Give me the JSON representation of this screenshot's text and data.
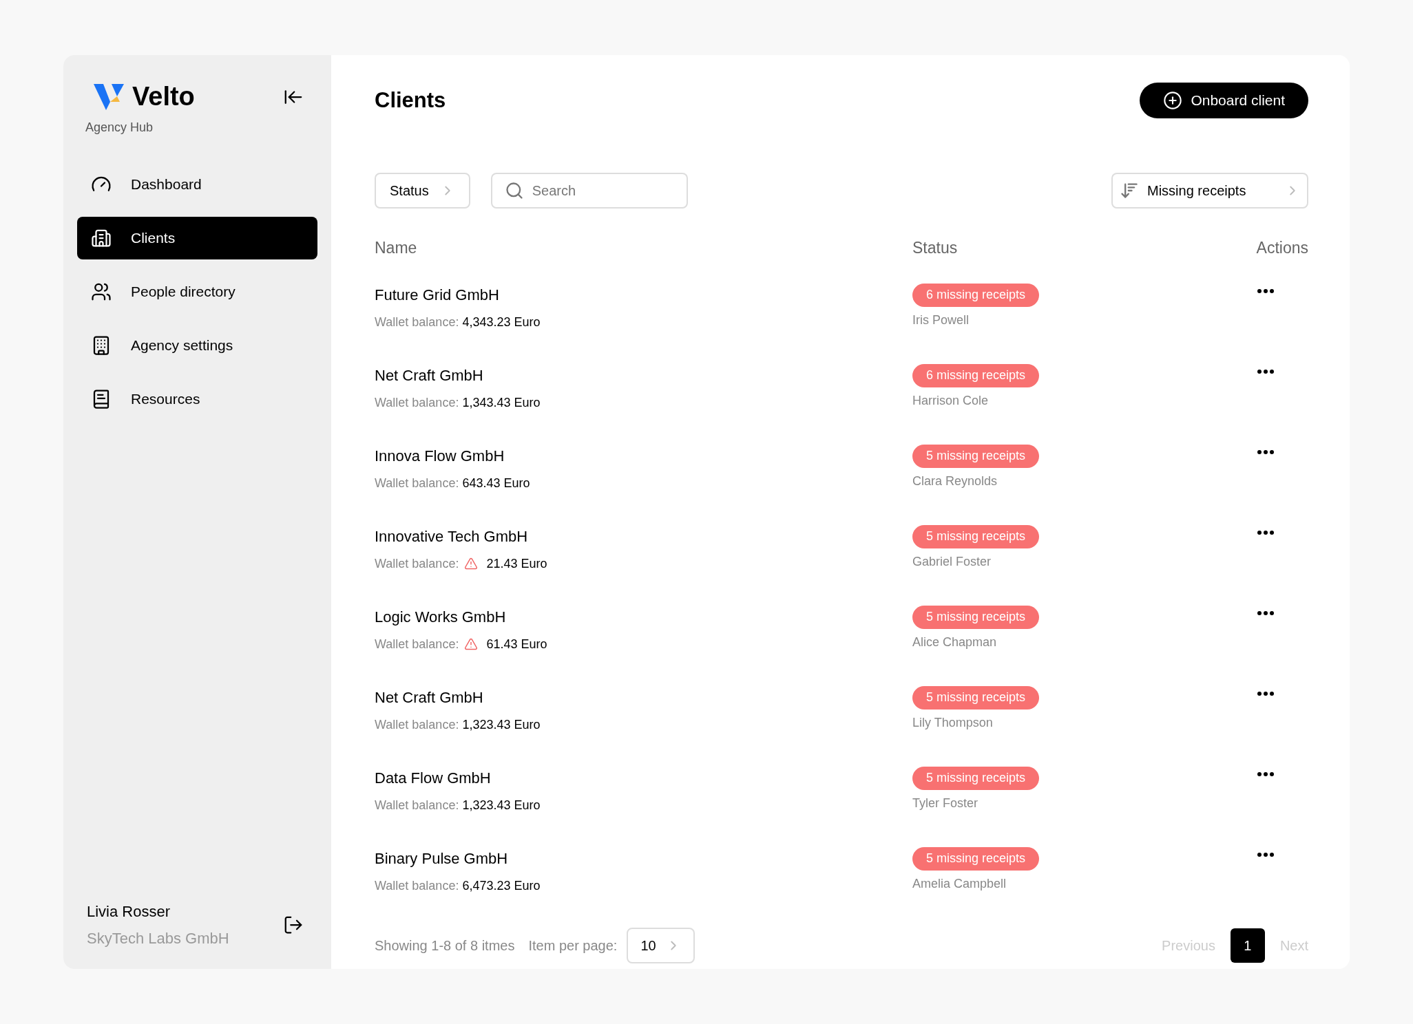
{
  "brand": {
    "name": "Velto",
    "subtitle": "Agency Hub"
  },
  "nav": [
    {
      "label": "Dashboard",
      "selected": false
    },
    {
      "label": "Clients",
      "selected": true
    },
    {
      "label": "People directory",
      "selected": false
    },
    {
      "label": "Agency settings",
      "selected": false
    },
    {
      "label": "Resources",
      "selected": false
    }
  ],
  "user": {
    "name": "Livia Rosser",
    "company": "SkyTech Labs GmbH"
  },
  "page_title": "Clients",
  "primary_action": "Onboard client",
  "filters": {
    "status": "Status",
    "search_placeholder": "Search",
    "sort": "Missing receipts"
  },
  "columns": [
    "Name",
    "Status",
    "Actions"
  ],
  "rows": [
    {
      "name": "Future Grid GmbH",
      "wallet_label": "Wallet balance:",
      "balance": "4,343.23 Euro",
      "low_balance": false,
      "status": "6 missing receipts",
      "person": "Iris Powell"
    },
    {
      "name": "Net Craft GmbH",
      "wallet_label": "Wallet balance:",
      "balance": "1,343.43 Euro",
      "low_balance": false,
      "status": "6 missing receipts",
      "person": "Harrison Cole"
    },
    {
      "name": "Innova Flow GmbH",
      "wallet_label": "Wallet balance:",
      "balance": "643.43 Euro",
      "low_balance": false,
      "status": "5 missing receipts",
      "person": "Clara Reynolds"
    },
    {
      "name": "Innovative Tech GmbH",
      "wallet_label": "Wallet balance:",
      "balance": "21.43 Euro",
      "low_balance": true,
      "status": "5 missing receipts",
      "person": "Gabriel Foster"
    },
    {
      "name": "Logic Works GmbH",
      "wallet_label": "Wallet balance:",
      "balance": "61.43 Euro",
      "low_balance": true,
      "status": "5 missing receipts",
      "person": "Alice Chapman"
    },
    {
      "name": "Net Craft GmbH",
      "wallet_label": "Wallet balance:",
      "balance": "1,323.43 Euro",
      "low_balance": false,
      "status": "5 missing receipts",
      "person": "Lily Thompson"
    },
    {
      "name": "Data Flow GmbH",
      "wallet_label": "Wallet balance:",
      "balance": "1,323.43 Euro",
      "low_balance": false,
      "status": "5 missing receipts",
      "person": "Tyler Foster"
    },
    {
      "name": "Binary Pulse GmbH",
      "wallet_label": "Wallet balance:",
      "balance": "6,473.23 Euro",
      "low_balance": false,
      "status": "5 missing receipts",
      "person": "Amelia Campbell"
    }
  ],
  "footer": {
    "showing": "Showing 1-8 of 8 itmes",
    "per_page_label": "Item per page:",
    "per_page": "10"
  },
  "pagination": {
    "previous": {
      "label": "Previous",
      "disabled": true
    },
    "pages": [
      {
        "label": "1",
        "selected": true
      }
    ],
    "next": {
      "label": "Next",
      "disabled": true
    }
  }
}
